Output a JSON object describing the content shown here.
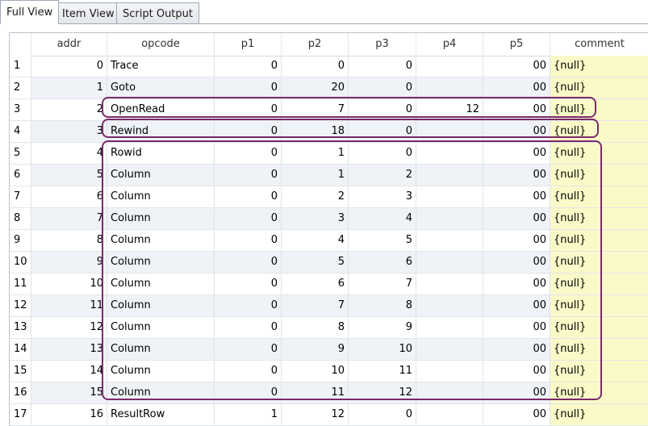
{
  "tabs": [
    {
      "label": "Full View"
    },
    {
      "label": "Item View"
    },
    {
      "label": "Script Output"
    }
  ],
  "grid": {
    "headers": [
      "addr",
      "opcode",
      "p1",
      "p2",
      "p3",
      "p4",
      "p5",
      "comment"
    ],
    "rows": [
      {
        "n": "1",
        "addr": "0",
        "opcode": "Trace",
        "p1": "0",
        "p2": "0",
        "p3": "0",
        "p4": "",
        "p5": "00",
        "comment": "{null}"
      },
      {
        "n": "2",
        "addr": "1",
        "opcode": "Goto",
        "p1": "0",
        "p2": "20",
        "p3": "0",
        "p4": "",
        "p5": "00",
        "comment": "{null}"
      },
      {
        "n": "3",
        "addr": "2",
        "opcode": "OpenRead",
        "p1": "0",
        "p2": "7",
        "p3": "0",
        "p4": "12",
        "p5": "00",
        "comment": "{null}"
      },
      {
        "n": "4",
        "addr": "3",
        "opcode": "Rewind",
        "p1": "0",
        "p2": "18",
        "p3": "0",
        "p4": "",
        "p5": "00",
        "comment": "{null}"
      },
      {
        "n": "5",
        "addr": "4",
        "opcode": "Rowid",
        "p1": "0",
        "p2": "1",
        "p3": "0",
        "p4": "",
        "p5": "00",
        "comment": "{null}"
      },
      {
        "n": "6",
        "addr": "5",
        "opcode": "Column",
        "p1": "0",
        "p2": "1",
        "p3": "2",
        "p4": "",
        "p5": "00",
        "comment": "{null}"
      },
      {
        "n": "7",
        "addr": "6",
        "opcode": "Column",
        "p1": "0",
        "p2": "2",
        "p3": "3",
        "p4": "",
        "p5": "00",
        "comment": "{null}"
      },
      {
        "n": "8",
        "addr": "7",
        "opcode": "Column",
        "p1": "0",
        "p2": "3",
        "p3": "4",
        "p4": "",
        "p5": "00",
        "comment": "{null}"
      },
      {
        "n": "9",
        "addr": "8",
        "opcode": "Column",
        "p1": "0",
        "p2": "4",
        "p3": "5",
        "p4": "",
        "p5": "00",
        "comment": "{null}"
      },
      {
        "n": "10",
        "addr": "9",
        "opcode": "Column",
        "p1": "0",
        "p2": "5",
        "p3": "6",
        "p4": "",
        "p5": "00",
        "comment": "{null}"
      },
      {
        "n": "11",
        "addr": "10",
        "opcode": "Column",
        "p1": "0",
        "p2": "6",
        "p3": "7",
        "p4": "",
        "p5": "00",
        "comment": "{null}"
      },
      {
        "n": "12",
        "addr": "11",
        "opcode": "Column",
        "p1": "0",
        "p2": "7",
        "p3": "8",
        "p4": "",
        "p5": "00",
        "comment": "{null}"
      },
      {
        "n": "13",
        "addr": "12",
        "opcode": "Column",
        "p1": "0",
        "p2": "8",
        "p3": "9",
        "p4": "",
        "p5": "00",
        "comment": "{null}"
      },
      {
        "n": "14",
        "addr": "13",
        "opcode": "Column",
        "p1": "0",
        "p2": "9",
        "p3": "10",
        "p4": "",
        "p5": "00",
        "comment": "{null}"
      },
      {
        "n": "15",
        "addr": "14",
        "opcode": "Column",
        "p1": "0",
        "p2": "10",
        "p3": "11",
        "p4": "",
        "p5": "00",
        "comment": "{null}"
      },
      {
        "n": "16",
        "addr": "15",
        "opcode": "Column",
        "p1": "0",
        "p2": "11",
        "p3": "12",
        "p4": "",
        "p5": "00",
        "comment": "{null}"
      },
      {
        "n": "17",
        "addr": "16",
        "opcode": "ResultRow",
        "p1": "1",
        "p2": "12",
        "p3": "0",
        "p4": "",
        "p5": "00",
        "comment": "{null}"
      }
    ]
  },
  "colors": {
    "highlight_outline": "#7a2a6a",
    "comment_background": "#fafac8",
    "alt_row_background": "#eff2f7"
  }
}
